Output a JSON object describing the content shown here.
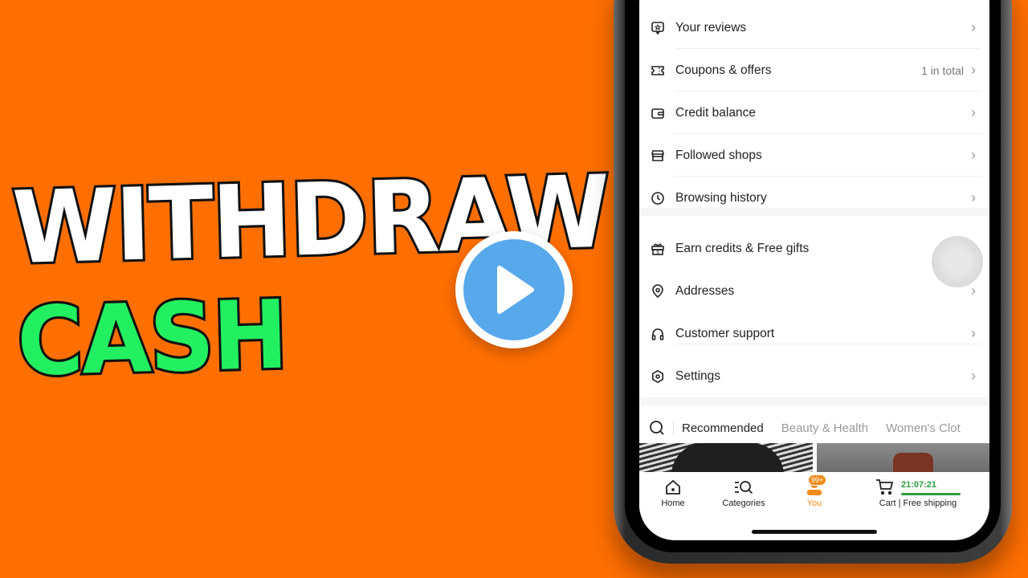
{
  "headline": {
    "line1": "WITHDRAW",
    "line2": "CASH"
  },
  "colors": {
    "background": "#ff6f00",
    "line1": "#ffffff",
    "line2": "#22f060",
    "play": "#58a8ec",
    "accent": "#f08a1a",
    "timer": "#2a9d3a"
  },
  "menu": {
    "group1": [
      {
        "icon": "review-icon",
        "label": "Your reviews",
        "extra": ""
      },
      {
        "icon": "coupon-icon",
        "label": "Coupons & offers",
        "extra": "1 in total"
      },
      {
        "icon": "wallet-icon",
        "label": "Credit balance",
        "extra": ""
      },
      {
        "icon": "shop-icon",
        "label": "Followed shops",
        "extra": ""
      },
      {
        "icon": "clock-icon",
        "label": "Browsing history",
        "extra": ""
      }
    ],
    "group2": [
      {
        "icon": "gift-icon",
        "label": "Earn credits & Free gifts",
        "extra": ""
      },
      {
        "icon": "location-icon",
        "label": "Addresses",
        "extra": ""
      },
      {
        "icon": "headset-icon",
        "label": "Customer support",
        "extra": ""
      },
      {
        "icon": "settings-icon",
        "label": "Settings",
        "extra": ""
      }
    ]
  },
  "tabs": [
    "Recommended",
    "Beauty & Health",
    "Women's Clot"
  ],
  "nav": {
    "home": "Home",
    "categories": "Categories",
    "you": "You",
    "you_badge": "99+",
    "cart": "Cart | Free shipping",
    "timer": "21:07:21"
  }
}
